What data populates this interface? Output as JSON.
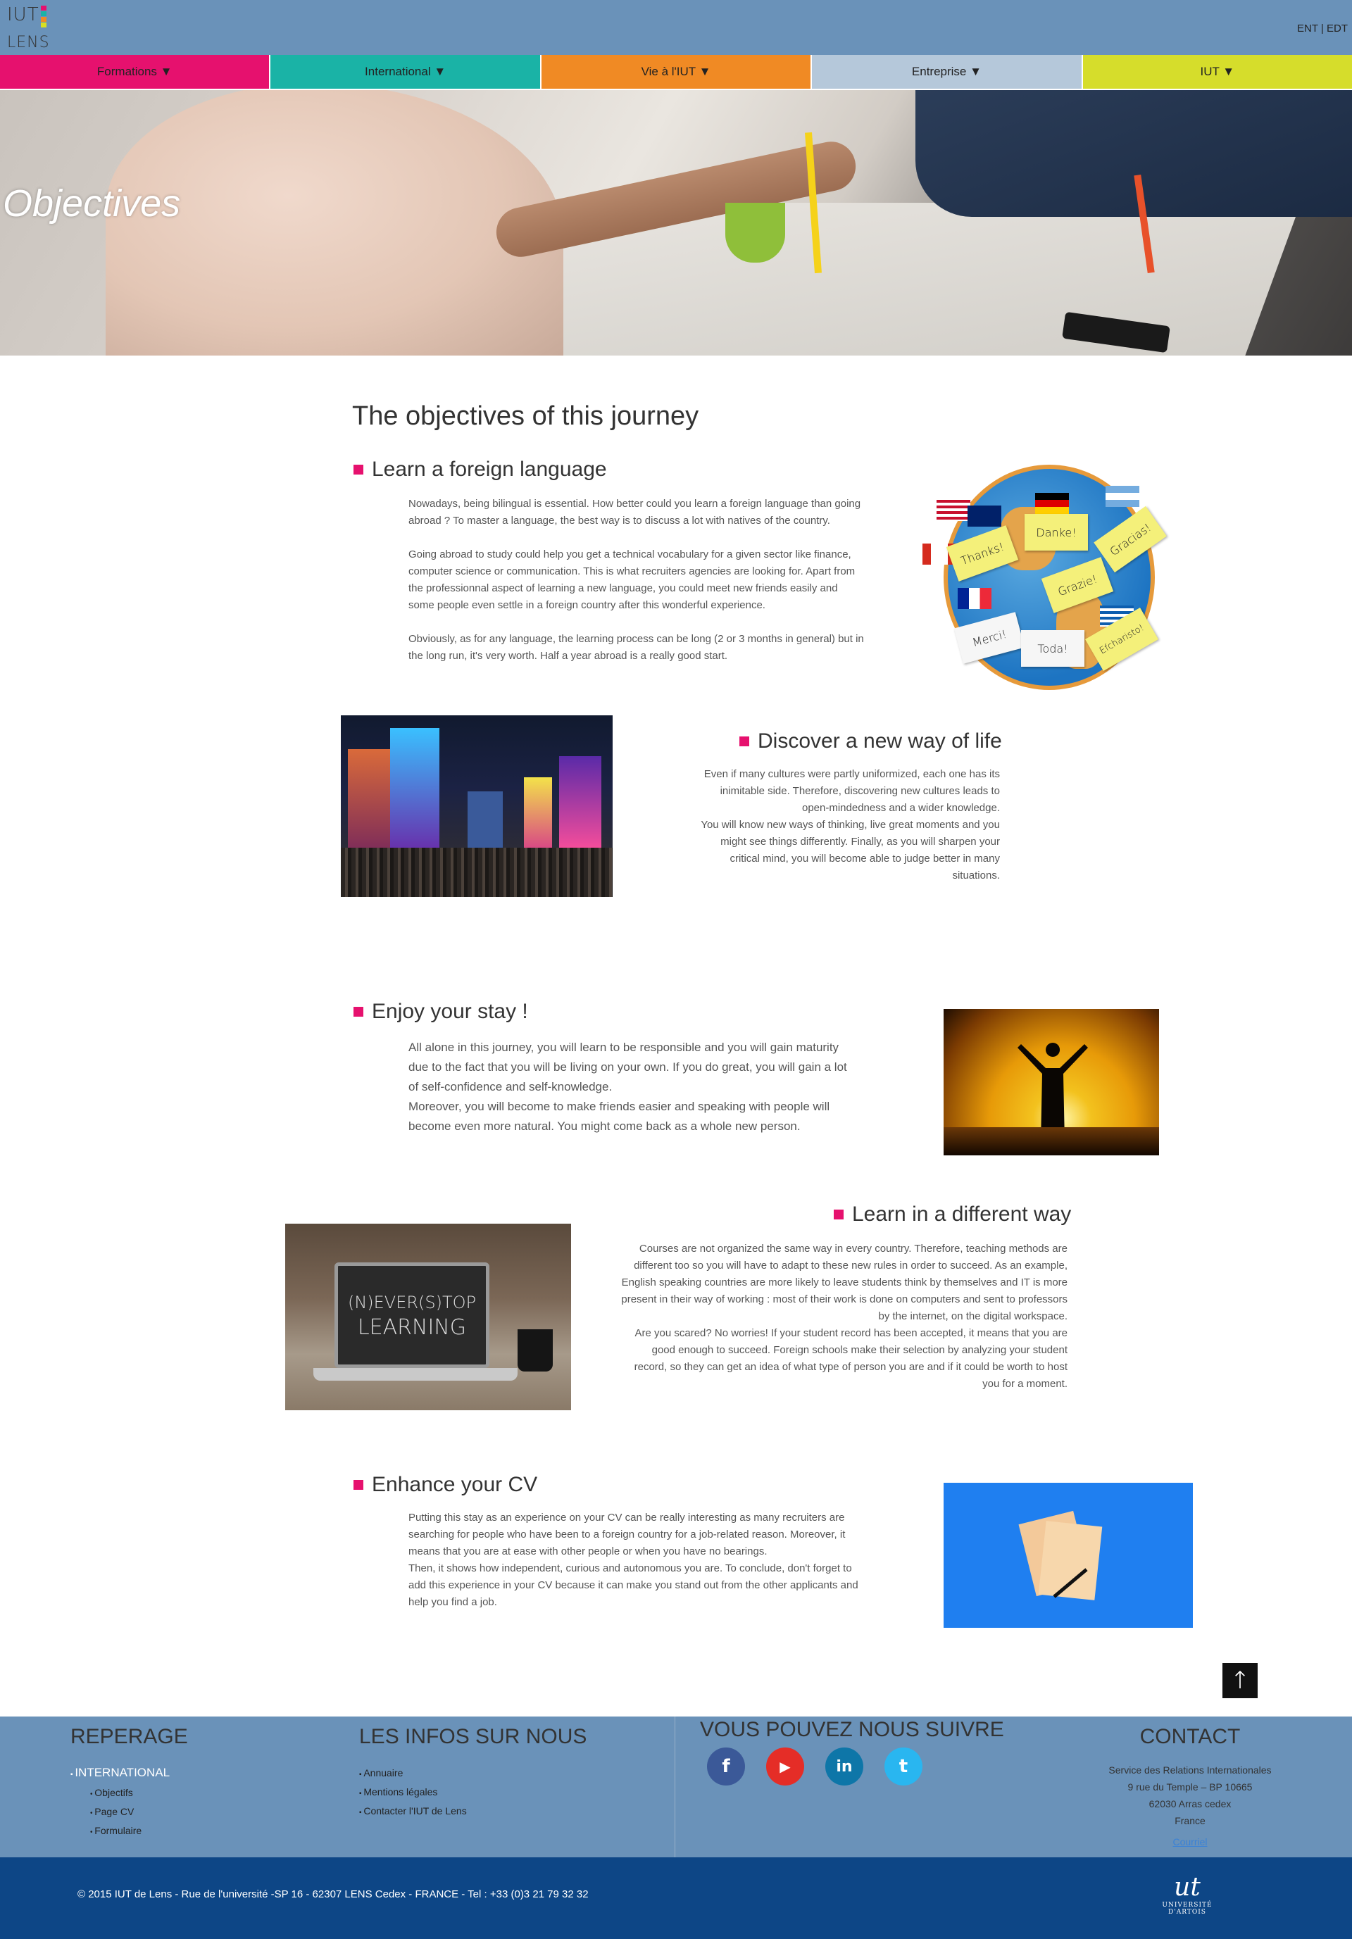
{
  "header": {
    "logo_top": "IUT",
    "logo_bottom": "LENS",
    "logo_colors": [
      "#e6116e",
      "#1ab3a6",
      "#f08a24",
      "#d9e021"
    ],
    "links": [
      "ENT",
      "EDT"
    ],
    "link_separator": "|"
  },
  "nav": [
    {
      "label": "Formations ▼",
      "color": "#e6116e"
    },
    {
      "label": "International ▼",
      "color": "#1ab3a6"
    },
    {
      "label": "Vie à l'IUT ▼",
      "color": "#f08a24"
    },
    {
      "label": "Entreprise ▼",
      "color": "#b5c8da"
    },
    {
      "label": "IUT ▼",
      "color": "#d6dd2b"
    }
  ],
  "hero": {
    "title": "Objectives"
  },
  "main": {
    "heading": "The objectives of this journey",
    "sections": [
      {
        "title": "Learn a foreign language",
        "text": "Nowadays, being bilingual is essential. How better could you learn a foreign language than going abroad ? To master a language, the best way is to discuss a lot with natives of the country.\n\nGoing abroad to study could help you get a technical vocabulary for a given sector like finance, computer science or communication. This is what recruiters agencies are looking for. Apart from the professionnal aspect of learning a new language, you could meet new friends easily and some people even settle in a foreign country after this wonderful experience.\n\nObviously, as for any language, the learning process can be long (2 or 3 months in general) but in the long run, it's very worth. Half a year abroad is a really good start."
      },
      {
        "title": "Discover a new way of life",
        "text": "Even if many cultures were partly uniformized, each one has its inimitable side. Therefore, discovering new cultures leads to open-mindedness and a wider knowledge.\nYou will know new ways of thinking, live great moments and you might see things differently. Finally, as you will sharpen your critical mind, you will become able to judge better in many situations."
      },
      {
        "title": "Enjoy your stay !",
        "text": "All alone in this journey, you will learn to be responsible and you will gain maturity due to the fact that you will be living on your own. If you do great, you will gain a lot of self-confidence and self-knowledge.\nMoreover, you will become to make friends easier and speaking with people will become even more natural. You might come back as a whole new person."
      },
      {
        "title": "Learn in a different way",
        "text": "Courses are not organized the same way in every country. Therefore, teaching methods are different too so you will have to adapt to these new rules in order to succeed. As an example, English speaking countries are more likely to leave students think by themselves and IT is more present in their way of working : most of their work is done on computers and sent to professors by the internet, on the digital workspace.\nAre you scared? No worries! If your student record has been accepted, it means that you are good enough to succeed. Foreign schools make their selection by analyzing your student record, so they can get an idea of what type of person you are and if it could be worth to host you for a moment."
      },
      {
        "title": "Enhance your CV",
        "text": "Putting this stay as an experience on your CV can be really interesting as many recruiters are searching for people who have been to a foreign country for a job-related reason. Moreover, it means that you are at ease with other people or when you have no bearings.\nThen, it shows how independent, curious and autonomous you are. To conclude, don't forget to add this experience in your CV because it can make you stand out from the other applicants and help you find a job."
      }
    ],
    "globe_notes": [
      "Thanks!",
      "Danke!",
      "Gracias!",
      "Grazie!",
      "Merci!",
      "Toda!",
      "Efcharisto!"
    ],
    "laptop_screen": [
      "(N)EVER(S)TOP",
      "LEARNING"
    ],
    "accent_color": "#e6116e"
  },
  "back_to_top": "↑",
  "footer": {
    "reperage": {
      "title": "REPERAGE",
      "main_item": "INTERNATIONAL",
      "sub_items": [
        "Objectifs",
        "Page CV",
        "Formulaire"
      ]
    },
    "infos": {
      "title": "LES INFOS SUR NOUS",
      "items": [
        "Annuaire",
        "Mentions légales",
        "Contacter l'IUT de Lens"
      ]
    },
    "follow": {
      "title": "VOUS POUVEZ NOUS SUIVRE",
      "networks": [
        {
          "icon": "facebook-icon",
          "glyph": "f",
          "color": "#3b5998"
        },
        {
          "icon": "youtube-icon",
          "glyph": "▶",
          "color": "#e52d27"
        },
        {
          "icon": "linkedin-icon",
          "glyph": "in",
          "color": "#0e76a8"
        },
        {
          "icon": "twitter-icon",
          "glyph": "t",
          "color": "#29b6f0"
        }
      ]
    },
    "contact": {
      "title": "CONTACT",
      "lines": [
        "Service des Relations Internationales",
        "9 rue du Temple – BP 10665",
        "62030 Arras cedex",
        "France"
      ],
      "mail_label": "Courriel"
    },
    "background": "#6a92b9"
  },
  "bottom": {
    "copyright": "© 2015 IUT de Lens - Rue de l'université -SP 16 - 62307 LENS Cedex - FRANCE - Tel : +33 (0)3 21 79 32 32",
    "univ_mark": "ut",
    "univ_name": "UNIVERSITÉ D'ARTOIS",
    "background": "#0d4686"
  }
}
